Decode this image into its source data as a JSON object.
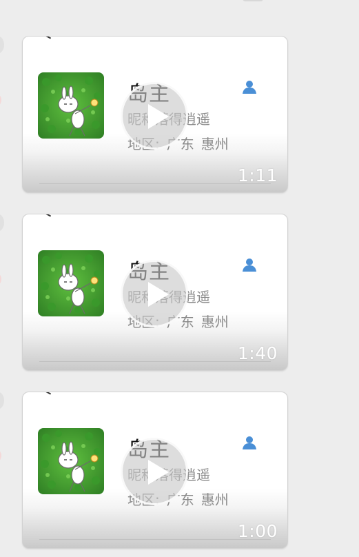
{
  "messages": [
    {
      "name": "岛主",
      "nickname_label": "昵称",
      "nickname": "落得逍遥",
      "region_label": "地区:",
      "region_province": "广东",
      "region_city": "惠州",
      "duration": "1:11",
      "icon": "contact-person-icon"
    },
    {
      "name": "岛主",
      "nickname_label": "昵称",
      "nickname": "落得逍遥",
      "region_label": "地区:",
      "region_province": "广东",
      "region_city": "惠州",
      "duration": "1:40",
      "icon": "contact-person-icon"
    },
    {
      "name": "岛主",
      "nickname_label": "昵称",
      "nickname": "落得逍遥",
      "region_label": "地区:",
      "region_province": "广东",
      "region_city": "惠州",
      "duration": "1:00",
      "icon": "contact-person-icon"
    }
  ],
  "colors": {
    "background": "#ededed",
    "card": "#ffffff",
    "accent_icon": "#4a8fd6",
    "muted_text": "#8a8a8a",
    "title_text": "#111111"
  }
}
